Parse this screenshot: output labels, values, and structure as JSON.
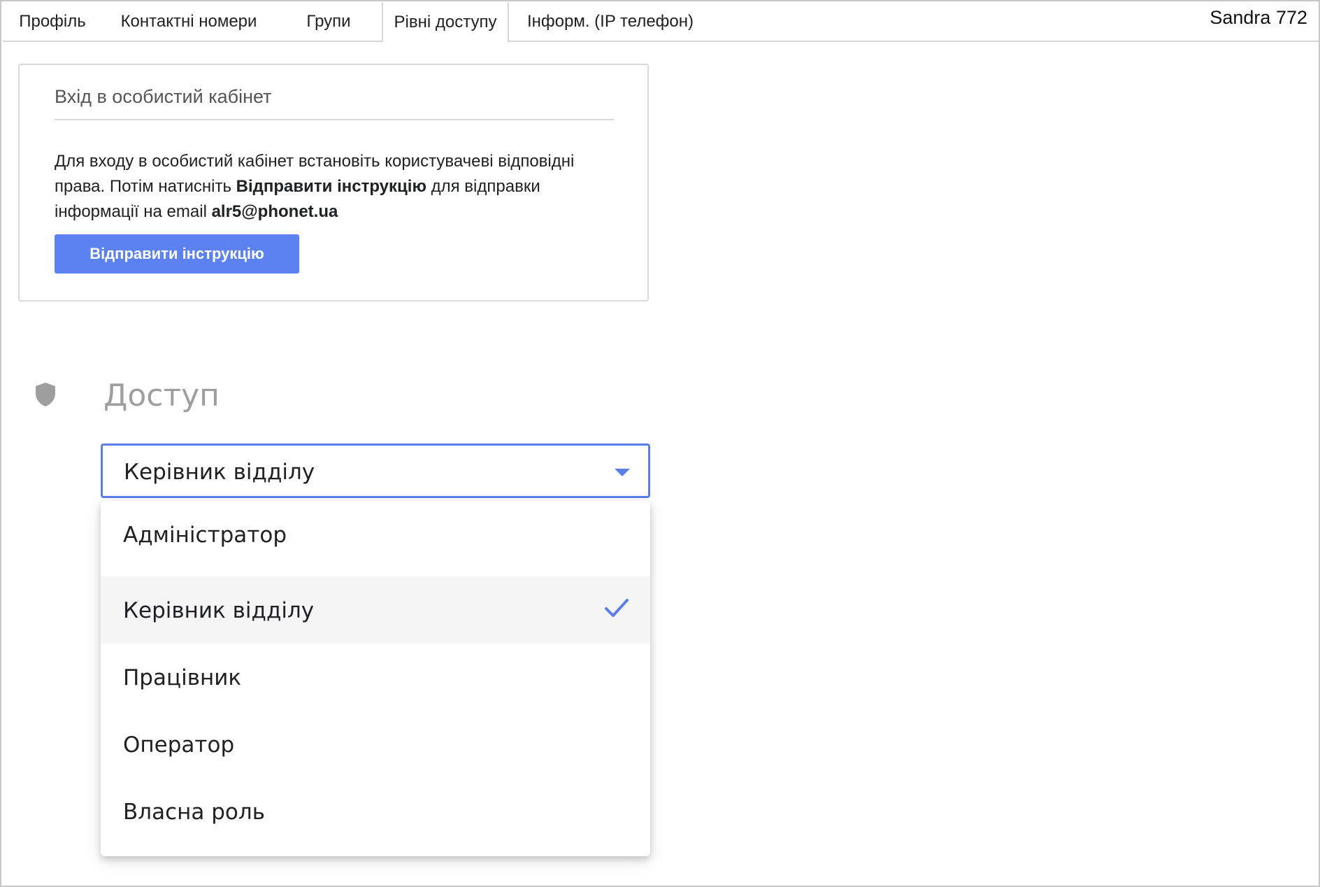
{
  "header": {
    "tabs": [
      {
        "label": "Профіль"
      },
      {
        "label": "Контактні номери"
      },
      {
        "label": "Групи"
      },
      {
        "label": "Рівні доступу"
      },
      {
        "label": "Інформ. (IP телефон)"
      }
    ],
    "active_tab": "Рівні доступу",
    "user": "Sandra 772"
  },
  "cabinet": {
    "title": "Вхід в особистий кабінет",
    "text_part1": "Для входу в особистий кабінет встановіть користувачеві відповідні права. Потім натисніть ",
    "text_bold_action": "Відправити інструкцію",
    "text_part2": " для відправки інформації на email ",
    "email": "alr5@phonet.ua",
    "button_label": "Відправити інструкцію"
  },
  "access": {
    "title": "Доступ",
    "icon": "shield-icon",
    "selected_value": "Керівник відділу",
    "options": [
      {
        "label": "Адміністратор",
        "selected": false
      },
      {
        "label": "Керівник відділу",
        "selected": true
      },
      {
        "label": "Працівник",
        "selected": false
      },
      {
        "label": "Оператор",
        "selected": false
      },
      {
        "label": "Власна роль",
        "selected": false
      }
    ]
  },
  "colors": {
    "accent": "#5b82f0",
    "select_border": "#5b7fea",
    "selected_option_bg": "#f5f5f5",
    "muted_title": "#9e9e9e"
  }
}
